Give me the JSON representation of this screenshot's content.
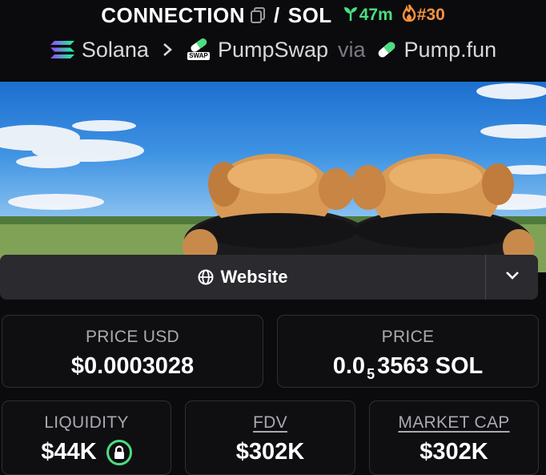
{
  "header": {
    "token_symbol": "CONNECTION",
    "separator": "/",
    "quote_symbol": "SOL",
    "age": "47m",
    "rank": "#30",
    "chain": "Solana",
    "dex": "PumpSwap",
    "dex_badge": "SWAP",
    "via": "via",
    "launchpad": "Pump.fun"
  },
  "links": {
    "website_label": "Website"
  },
  "stats": {
    "price_usd": {
      "label": "PRICE USD",
      "value": "$0.0003028"
    },
    "price_native": {
      "label": "PRICE",
      "value_prefix": "0.0",
      "value_zeros": "5",
      "value_suffix": "3563 SOL"
    },
    "liquidity": {
      "label": "LIQUIDITY",
      "value": "$44K"
    },
    "fdv": {
      "label": "FDV",
      "value": "$302K"
    },
    "market_cap": {
      "label": "MARKET CAP",
      "value": "$302K"
    }
  },
  "colors": {
    "background": "#0b0b0e",
    "age_green": "#4ade80",
    "rank_orange": "#fb923c",
    "card_border": "#2e2e35",
    "button_bg": "#2a2a2f"
  },
  "icons": [
    "copy-icon",
    "sprout-icon",
    "flame-icon",
    "solana-icon",
    "chevron-right-icon",
    "pumpswap-icon",
    "pill-icon",
    "globe-icon",
    "chevron-down-icon",
    "lock-icon"
  ]
}
